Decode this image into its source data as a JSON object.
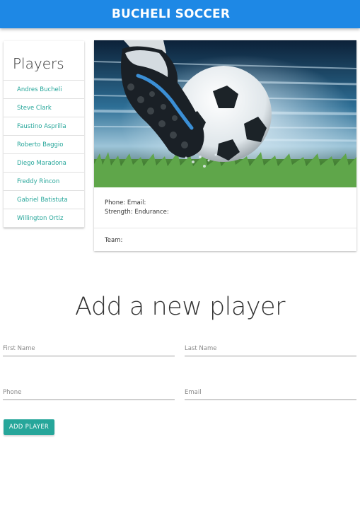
{
  "navbar": {
    "brand": "BUCHELI SOCCER"
  },
  "players": {
    "title": "Players",
    "items": [
      "Andres Bucheli",
      "Steve Clark",
      "Faustino Asprilla",
      "Roberto Baggio",
      "Diego Maradona",
      "Freddy Rincon",
      "Gabriel Batistuta",
      "Willington Ortiz"
    ]
  },
  "detail": {
    "image": "soccer-cleat-kicking-ball-photo",
    "contact_line": "Phone: Email:",
    "stats_line": "Strength: Endurance:",
    "team_line": "Team:"
  },
  "form": {
    "title": "Add a new player",
    "first_name_placeholder": "First Name",
    "last_name_placeholder": "Last Name",
    "phone_placeholder": "Phone",
    "email_placeholder": "Email",
    "submit_label": "ADD PLAYER"
  },
  "colors": {
    "navbar": "#1e88e5",
    "accent": "#26a69a"
  }
}
